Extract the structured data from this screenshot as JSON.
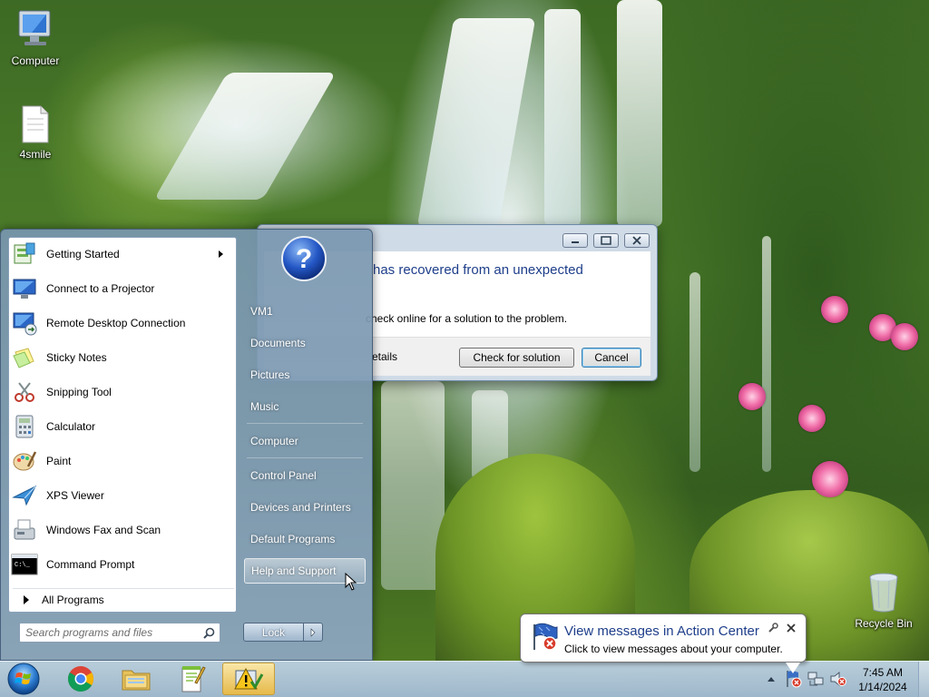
{
  "desktop": {
    "icons": [
      {
        "label": "Computer",
        "icon": "computer-icon"
      },
      {
        "label": "4smile",
        "icon": "text-document-icon"
      },
      {
        "label": "Recycle Bin",
        "icon": "recycle-bin-icon"
      }
    ]
  },
  "dialog": {
    "title_text": "has recovered from an unexpected",
    "body_text": "check online for a solution to the problem.",
    "details_text": "etails",
    "check_button": "Check for solution",
    "cancel_button": "Cancel"
  },
  "start_menu": {
    "programs": [
      {
        "label": "Getting Started",
        "icon": "getting-started-icon",
        "has_submenu": true
      },
      {
        "label": "Connect to a Projector",
        "icon": "projector-icon",
        "has_submenu": false
      },
      {
        "label": "Remote Desktop Connection",
        "icon": "remote-desktop-icon",
        "has_submenu": false
      },
      {
        "label": "Sticky Notes",
        "icon": "sticky-notes-icon",
        "has_submenu": false
      },
      {
        "label": "Snipping Tool",
        "icon": "snipping-tool-icon",
        "has_submenu": false
      },
      {
        "label": "Calculator",
        "icon": "calculator-icon",
        "has_submenu": false
      },
      {
        "label": "Paint",
        "icon": "paint-icon",
        "has_submenu": false
      },
      {
        "label": "XPS Viewer",
        "icon": "xps-viewer-icon",
        "has_submenu": false
      },
      {
        "label": "Windows Fax and Scan",
        "icon": "fax-scan-icon",
        "has_submenu": false
      },
      {
        "label": "Command Prompt",
        "icon": "command-prompt-icon",
        "has_submenu": false
      }
    ],
    "all_programs": "All Programs",
    "search_placeholder": "Search programs and files",
    "right_links": [
      {
        "label": "VM1"
      },
      {
        "label": "Documents"
      },
      {
        "label": "Pictures"
      },
      {
        "label": "Music"
      },
      {
        "label": "Computer"
      },
      {
        "label": "Control Panel"
      },
      {
        "label": "Devices and Printers"
      },
      {
        "label": "Default Programs"
      },
      {
        "label": "Help and Support"
      }
    ],
    "lock_button": "Lock"
  },
  "taskbar": {
    "items": [
      {
        "icon": "start-orb-icon"
      },
      {
        "icon": "chrome-icon"
      },
      {
        "icon": "file-explorer-icon"
      },
      {
        "icon": "notepad-plus-plus-icon"
      },
      {
        "icon": "action-center-warning-icon"
      }
    ],
    "clock_time": "7:45 AM",
    "clock_date": "1/14/2024"
  },
  "balloon": {
    "title": "View messages in Action Center",
    "subtitle": "Click to view messages about your computer."
  },
  "colors": {
    "link_blue": "#1e3e8a",
    "start_menu_frame": "#7f9ab4",
    "taskbar": "#b6cce0"
  }
}
